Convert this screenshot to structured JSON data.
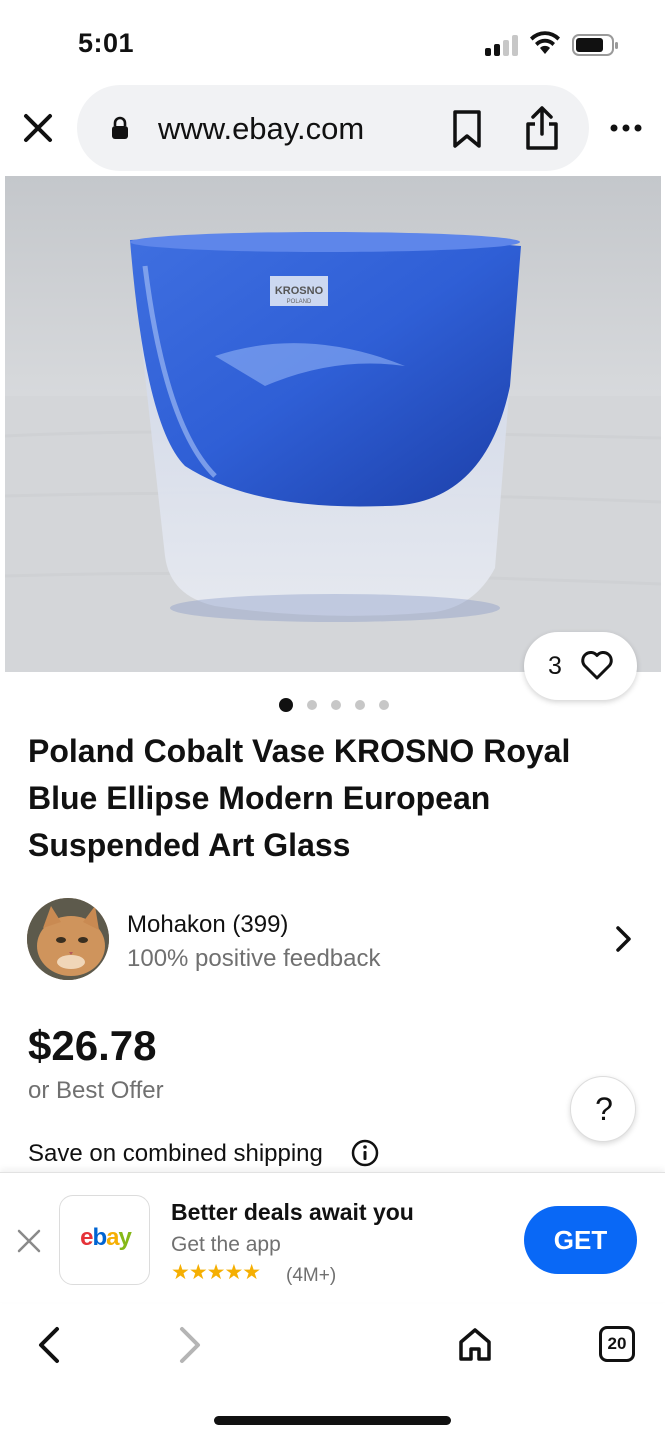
{
  "status_bar": {
    "time": "5:01"
  },
  "browser": {
    "url": "www.ebay.com",
    "icons": [
      "close-icon",
      "lock-icon",
      "bookmark-icon",
      "share-icon",
      "more-icon"
    ]
  },
  "product": {
    "image_label": "KROSNO",
    "image_sublabel": "POLAND",
    "watch_count": "3",
    "carousel_total": 5,
    "carousel_active": 1,
    "title": "Poland Cobalt Vase KROSNO Royal Blue Ellipse Modern European Suspended Art Glass",
    "price": "$26.78",
    "best_offer": "or Best Offer",
    "shipping_note": "Save on combined shipping"
  },
  "seller": {
    "name": "Mohakon (399)",
    "feedback": "100% positive feedback"
  },
  "help": {
    "label": "?"
  },
  "app_banner": {
    "logo": "ebay",
    "title": "Better deals await you",
    "subtitle": "Get the app",
    "stars": "★★★★★",
    "rating_count": "(4M+)",
    "get_label": "GET",
    "colors": {
      "get_button": "#0968f6",
      "stars": "#f5af02"
    }
  },
  "bottom_nav": {
    "tab_count": "20"
  }
}
